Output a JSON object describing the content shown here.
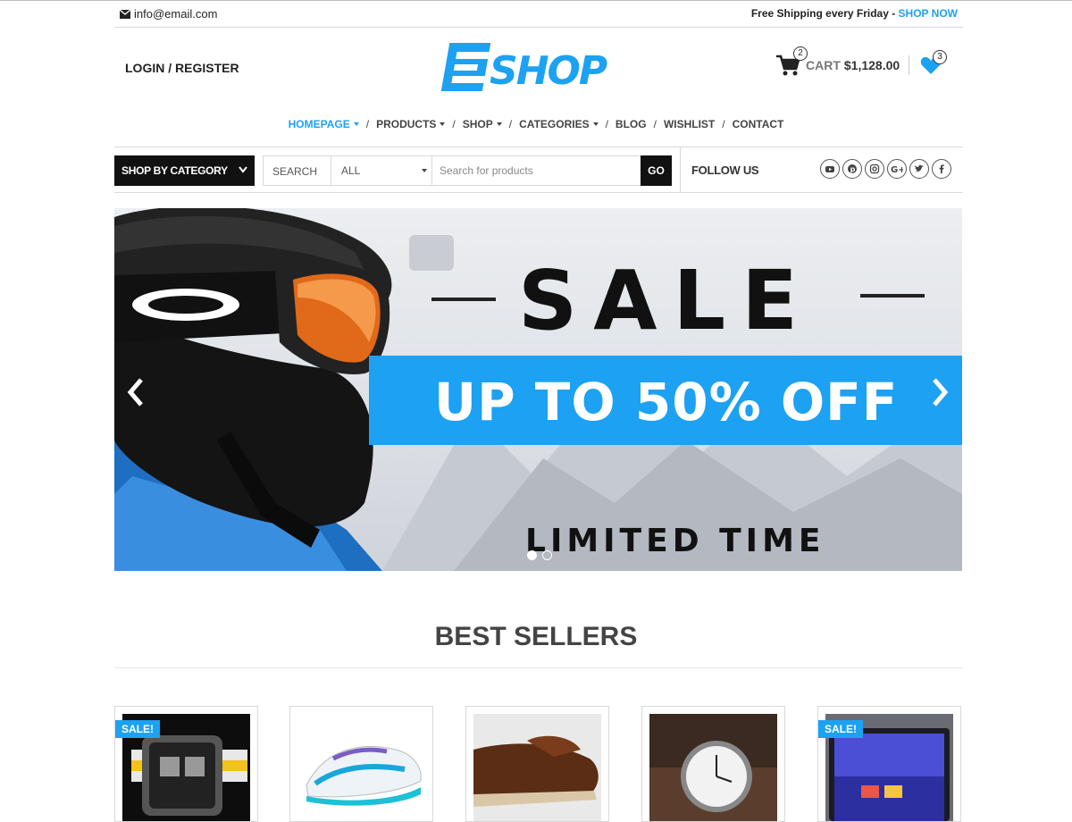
{
  "topbar": {
    "email": "info@email.com",
    "shipping_text": "Free Shipping every Friday - ",
    "shop_now": "SHOP NOW"
  },
  "header": {
    "login_register": "LOGIN / REGISTER",
    "logo_text": "ESHOP",
    "cart_count": "2",
    "cart_label": "CART",
    "cart_total": "$1,128.00",
    "wishlist_count": "3"
  },
  "nav": {
    "items": [
      {
        "label": "HOMEPAGE",
        "dropdown": true,
        "active": true
      },
      {
        "label": "PRODUCTS",
        "dropdown": true
      },
      {
        "label": "SHOP",
        "dropdown": true
      },
      {
        "label": "CATEGORIES",
        "dropdown": true
      },
      {
        "label": "BLOG",
        "dropdown": false
      },
      {
        "label": "WISHLIST",
        "dropdown": false
      },
      {
        "label": "CONTACT",
        "dropdown": false
      }
    ],
    "separator": "/"
  },
  "search_bar": {
    "shop_by_category": "SHOP BY CATEGORY",
    "search_label": "SEARCH",
    "category_select_value": "ALL",
    "placeholder": "Search for products",
    "go_label": "GO",
    "follow_us": "FOLLOW US",
    "social_icons": [
      "youtube-icon",
      "pinterest-icon",
      "instagram-icon",
      "google-plus-icon",
      "twitter-icon",
      "facebook-icon"
    ]
  },
  "hero": {
    "headline": "SALE",
    "offer": "UP TO 50% OFF",
    "tagline": "LIMITED TIME"
  },
  "best_sellers": {
    "title": "BEST SELLERS",
    "sale_badge": "SALE!",
    "products": [
      {
        "image": "watch-black",
        "sale": true
      },
      {
        "image": "running-shoe",
        "sale": false
      },
      {
        "image": "leather-shoe",
        "sale": false
      },
      {
        "image": "wrist-watch",
        "sale": false
      },
      {
        "image": "tablet",
        "sale": true
      }
    ]
  },
  "colors": {
    "accent": "#1da1f2",
    "dark": "#111111",
    "text": "#222222"
  }
}
